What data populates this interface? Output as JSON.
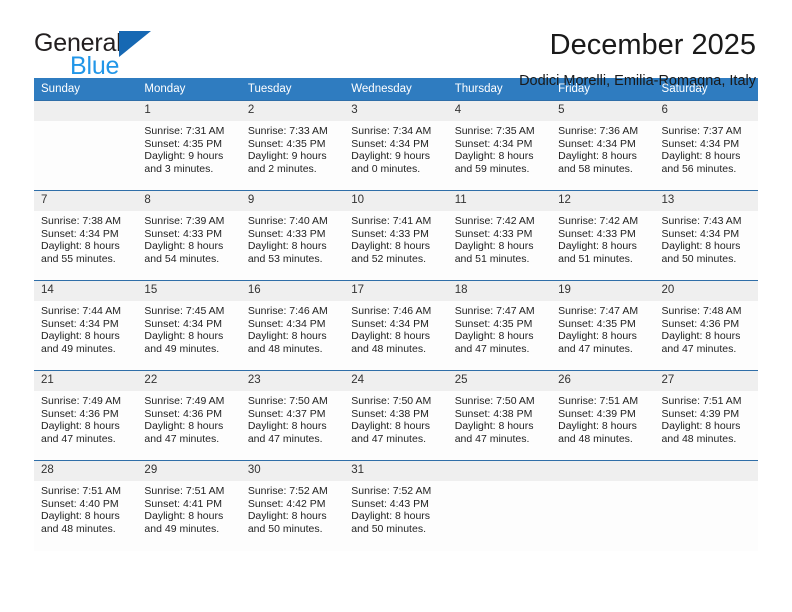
{
  "brand": {
    "word_general": "General",
    "word_blue": "Blue",
    "logo_icon": "triangle-logo-icon"
  },
  "header": {
    "title": "December 2025",
    "subtitle": "Dodici Morelli, Emilia-Romagna, Italy"
  },
  "colors": {
    "header_bar": "#2f7cc0",
    "daynum_band": "#efefef",
    "row_divider": "#2f6ea8",
    "brand_blue": "#2196e8",
    "brand_logo": "#1668b3"
  },
  "weekdays": [
    "Sunday",
    "Monday",
    "Tuesday",
    "Wednesday",
    "Thursday",
    "Friday",
    "Saturday"
  ],
  "labels": {
    "sunrise_prefix": "Sunrise:",
    "sunset_prefix": "Sunset:",
    "daylight_prefix": "Daylight:"
  },
  "weeks": [
    [
      {
        "day": "",
        "empty": true,
        "sunrise": "",
        "sunset": "",
        "daylight_a": "",
        "daylight_b": ""
      },
      {
        "day": "1",
        "sunrise": "Sunrise: 7:31 AM",
        "sunset": "Sunset: 4:35 PM",
        "daylight_a": "Daylight: 9 hours",
        "daylight_b": "and 3 minutes."
      },
      {
        "day": "2",
        "sunrise": "Sunrise: 7:33 AM",
        "sunset": "Sunset: 4:35 PM",
        "daylight_a": "Daylight: 9 hours",
        "daylight_b": "and 2 minutes."
      },
      {
        "day": "3",
        "sunrise": "Sunrise: 7:34 AM",
        "sunset": "Sunset: 4:34 PM",
        "daylight_a": "Daylight: 9 hours",
        "daylight_b": "and 0 minutes."
      },
      {
        "day": "4",
        "sunrise": "Sunrise: 7:35 AM",
        "sunset": "Sunset: 4:34 PM",
        "daylight_a": "Daylight: 8 hours",
        "daylight_b": "and 59 minutes."
      },
      {
        "day": "5",
        "sunrise": "Sunrise: 7:36 AM",
        "sunset": "Sunset: 4:34 PM",
        "daylight_a": "Daylight: 8 hours",
        "daylight_b": "and 58 minutes."
      },
      {
        "day": "6",
        "sunrise": "Sunrise: 7:37 AM",
        "sunset": "Sunset: 4:34 PM",
        "daylight_a": "Daylight: 8 hours",
        "daylight_b": "and 56 minutes."
      }
    ],
    [
      {
        "day": "7",
        "sunrise": "Sunrise: 7:38 AM",
        "sunset": "Sunset: 4:34 PM",
        "daylight_a": "Daylight: 8 hours",
        "daylight_b": "and 55 minutes."
      },
      {
        "day": "8",
        "sunrise": "Sunrise: 7:39 AM",
        "sunset": "Sunset: 4:33 PM",
        "daylight_a": "Daylight: 8 hours",
        "daylight_b": "and 54 minutes."
      },
      {
        "day": "9",
        "sunrise": "Sunrise: 7:40 AM",
        "sunset": "Sunset: 4:33 PM",
        "daylight_a": "Daylight: 8 hours",
        "daylight_b": "and 53 minutes."
      },
      {
        "day": "10",
        "sunrise": "Sunrise: 7:41 AM",
        "sunset": "Sunset: 4:33 PM",
        "daylight_a": "Daylight: 8 hours",
        "daylight_b": "and 52 minutes."
      },
      {
        "day": "11",
        "sunrise": "Sunrise: 7:42 AM",
        "sunset": "Sunset: 4:33 PM",
        "daylight_a": "Daylight: 8 hours",
        "daylight_b": "and 51 minutes."
      },
      {
        "day": "12",
        "sunrise": "Sunrise: 7:42 AM",
        "sunset": "Sunset: 4:33 PM",
        "daylight_a": "Daylight: 8 hours",
        "daylight_b": "and 51 minutes."
      },
      {
        "day": "13",
        "sunrise": "Sunrise: 7:43 AM",
        "sunset": "Sunset: 4:34 PM",
        "daylight_a": "Daylight: 8 hours",
        "daylight_b": "and 50 minutes."
      }
    ],
    [
      {
        "day": "14",
        "sunrise": "Sunrise: 7:44 AM",
        "sunset": "Sunset: 4:34 PM",
        "daylight_a": "Daylight: 8 hours",
        "daylight_b": "and 49 minutes."
      },
      {
        "day": "15",
        "sunrise": "Sunrise: 7:45 AM",
        "sunset": "Sunset: 4:34 PM",
        "daylight_a": "Daylight: 8 hours",
        "daylight_b": "and 49 minutes."
      },
      {
        "day": "16",
        "sunrise": "Sunrise: 7:46 AM",
        "sunset": "Sunset: 4:34 PM",
        "daylight_a": "Daylight: 8 hours",
        "daylight_b": "and 48 minutes."
      },
      {
        "day": "17",
        "sunrise": "Sunrise: 7:46 AM",
        "sunset": "Sunset: 4:34 PM",
        "daylight_a": "Daylight: 8 hours",
        "daylight_b": "and 48 minutes."
      },
      {
        "day": "18",
        "sunrise": "Sunrise: 7:47 AM",
        "sunset": "Sunset: 4:35 PM",
        "daylight_a": "Daylight: 8 hours",
        "daylight_b": "and 47 minutes."
      },
      {
        "day": "19",
        "sunrise": "Sunrise: 7:47 AM",
        "sunset": "Sunset: 4:35 PM",
        "daylight_a": "Daylight: 8 hours",
        "daylight_b": "and 47 minutes."
      },
      {
        "day": "20",
        "sunrise": "Sunrise: 7:48 AM",
        "sunset": "Sunset: 4:36 PM",
        "daylight_a": "Daylight: 8 hours",
        "daylight_b": "and 47 minutes."
      }
    ],
    [
      {
        "day": "21",
        "sunrise": "Sunrise: 7:49 AM",
        "sunset": "Sunset: 4:36 PM",
        "daylight_a": "Daylight: 8 hours",
        "daylight_b": "and 47 minutes."
      },
      {
        "day": "22",
        "sunrise": "Sunrise: 7:49 AM",
        "sunset": "Sunset: 4:36 PM",
        "daylight_a": "Daylight: 8 hours",
        "daylight_b": "and 47 minutes."
      },
      {
        "day": "23",
        "sunrise": "Sunrise: 7:50 AM",
        "sunset": "Sunset: 4:37 PM",
        "daylight_a": "Daylight: 8 hours",
        "daylight_b": "and 47 minutes."
      },
      {
        "day": "24",
        "sunrise": "Sunrise: 7:50 AM",
        "sunset": "Sunset: 4:38 PM",
        "daylight_a": "Daylight: 8 hours",
        "daylight_b": "and 47 minutes."
      },
      {
        "day": "25",
        "sunrise": "Sunrise: 7:50 AM",
        "sunset": "Sunset: 4:38 PM",
        "daylight_a": "Daylight: 8 hours",
        "daylight_b": "and 47 minutes."
      },
      {
        "day": "26",
        "sunrise": "Sunrise: 7:51 AM",
        "sunset": "Sunset: 4:39 PM",
        "daylight_a": "Daylight: 8 hours",
        "daylight_b": "and 48 minutes."
      },
      {
        "day": "27",
        "sunrise": "Sunrise: 7:51 AM",
        "sunset": "Sunset: 4:39 PM",
        "daylight_a": "Daylight: 8 hours",
        "daylight_b": "and 48 minutes."
      }
    ],
    [
      {
        "day": "28",
        "sunrise": "Sunrise: 7:51 AM",
        "sunset": "Sunset: 4:40 PM",
        "daylight_a": "Daylight: 8 hours",
        "daylight_b": "and 48 minutes."
      },
      {
        "day": "29",
        "sunrise": "Sunrise: 7:51 AM",
        "sunset": "Sunset: 4:41 PM",
        "daylight_a": "Daylight: 8 hours",
        "daylight_b": "and 49 minutes."
      },
      {
        "day": "30",
        "sunrise": "Sunrise: 7:52 AM",
        "sunset": "Sunset: 4:42 PM",
        "daylight_a": "Daylight: 8 hours",
        "daylight_b": "and 50 minutes."
      },
      {
        "day": "31",
        "sunrise": "Sunrise: 7:52 AM",
        "sunset": "Sunset: 4:43 PM",
        "daylight_a": "Daylight: 8 hours",
        "daylight_b": "and 50 minutes."
      },
      {
        "day": "",
        "empty": true,
        "sunrise": "",
        "sunset": "",
        "daylight_a": "",
        "daylight_b": ""
      },
      {
        "day": "",
        "empty": true,
        "sunrise": "",
        "sunset": "",
        "daylight_a": "",
        "daylight_b": ""
      },
      {
        "day": "",
        "empty": true,
        "sunrise": "",
        "sunset": "",
        "daylight_a": "",
        "daylight_b": ""
      }
    ]
  ]
}
